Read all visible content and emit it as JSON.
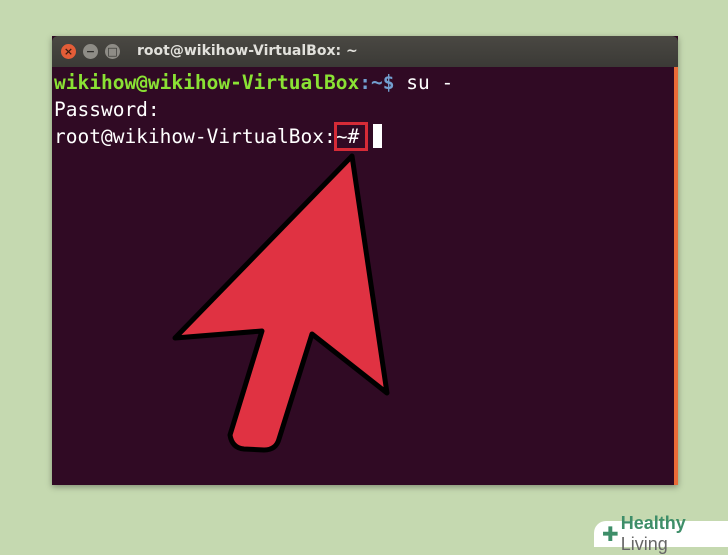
{
  "window": {
    "title": "root@wikihow-VirtualBox: ~",
    "close_glyph": "×",
    "min_glyph": "−",
    "max_glyph": "□"
  },
  "terminal": {
    "line1": {
      "user_host": "wikihow@wikihow-VirtualBox",
      "path": ":~$",
      "command": " su -"
    },
    "line2": {
      "text": "Password:"
    },
    "line3": {
      "prompt": "root@wikihow-VirtualBox:",
      "tilde": "~",
      "hash": "#"
    }
  },
  "logo": {
    "brand": "Healthy",
    "suffix": " Living",
    "plus": "✚"
  },
  "colors": {
    "terminal_bg": "#300a24",
    "prompt_green": "#8ae234",
    "path_blue": "#729fcf",
    "highlight_red": "#d52b37",
    "arrow_red": "#e03242",
    "background": "#c5d9b0"
  },
  "annotation": {
    "type": "arrow",
    "points_to": "root prompt symbol"
  }
}
